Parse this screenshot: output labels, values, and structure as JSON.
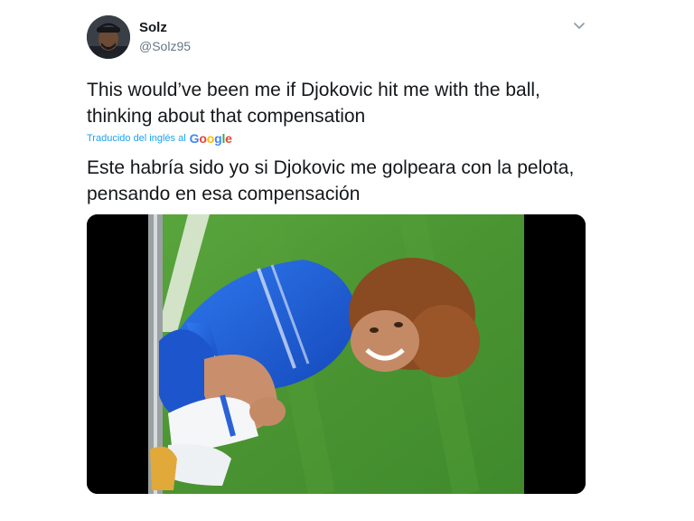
{
  "tweet": {
    "display_name": "Solz",
    "handle": "@Solz95",
    "text": "This would’ve been me if Djokovic hit me with the ball, thinking about that compensation",
    "translated_from": "Traducido del inglés al",
    "google": [
      "G",
      "o",
      "o",
      "g",
      "l",
      "e"
    ],
    "translation": "Este habría sido yo si Djokovic me golpeara con la pelota, pensando en esa compensación",
    "media_alt": "Player in blue kit lying on grass pitch, holding his leg and grinning"
  },
  "icons": {
    "menu": "chevron-down-icon",
    "avatar": "user-avatar"
  },
  "colors": {
    "link": "#1da1f2",
    "text": "#14171a",
    "secondary": "#657786",
    "pitch": "#4f9a34",
    "kit": "#1b5fd8"
  }
}
